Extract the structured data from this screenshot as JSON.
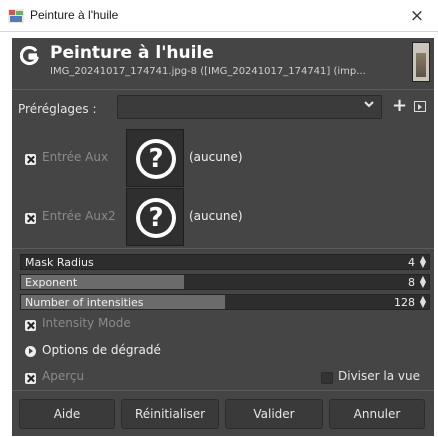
{
  "window": {
    "title": "Peinture à l'huile",
    "close_glyph": "×"
  },
  "plugin": {
    "title": "Peinture à l'huile",
    "subtitle": "IMG_20241017_174741.jpg-8 ([IMG_20241017_174741] (imp..."
  },
  "presets": {
    "label": "Préréglages :",
    "value": "",
    "add_glyph": "+"
  },
  "aux": [
    {
      "label": "Entrée Aux",
      "value": "(aucune)",
      "placeholder_glyph": "?"
    },
    {
      "label": "Entrée Aux2",
      "value": "(aucune)",
      "placeholder_glyph": "?"
    }
  ],
  "spinners": [
    {
      "label": "Mask Radius",
      "value": "4",
      "fill_fraction": 0.0
    },
    {
      "label": "Exponent",
      "value": "8",
      "fill_fraction": 0.4
    },
    {
      "label": "Number of intensities",
      "value": "128",
      "fill_fraction": 0.5
    }
  ],
  "intensity_mode": {
    "label": "Intensity Mode",
    "checked": true
  },
  "gradient_options": {
    "label": "Options de dégradé"
  },
  "preview": {
    "label": "Aperçu",
    "checked": true
  },
  "split_view": {
    "label": "Diviser la vue",
    "checked": false
  },
  "buttons": {
    "help": "Aide",
    "reset": "Réinitialiser",
    "ok": "Valider",
    "cancel": "Annuler"
  },
  "colors": {
    "dialog_bg": "#454545",
    "spinner_fill": "#6b6b6b",
    "text": "#dcdcdc",
    "disabled_text": "#8a8a8a"
  },
  "icons": {
    "app": "oil-painting-app-icon",
    "logo": "gimp-g-logo",
    "aux_placeholder": "question-mark-circle-icon",
    "presets_menu": "dialog-menu-icon"
  }
}
